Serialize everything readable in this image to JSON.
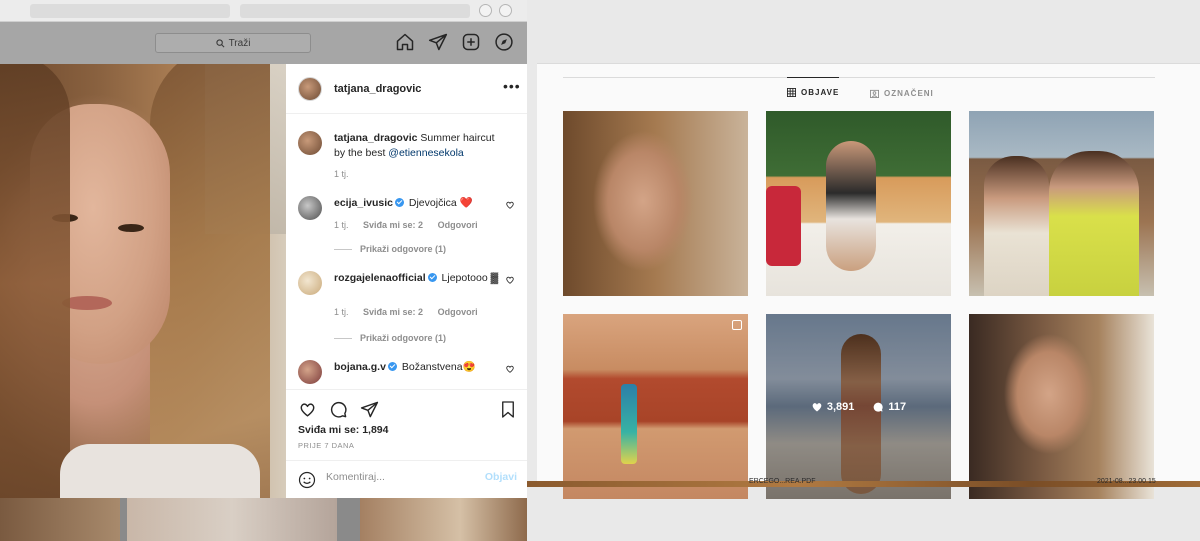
{
  "left_window": {
    "search": {
      "placeholder": "Traži"
    },
    "nav_icons": [
      "home-icon",
      "direct-icon",
      "new-post-icon",
      "explore-icon",
      "activity-icon"
    ],
    "post": {
      "username": "tatjana_dragovic",
      "caption": {
        "username": "tatjana_dragovic",
        "text": "Summer haircut by the best",
        "mention": "@etiennesekola",
        "time": "1 tj."
      },
      "comments": [
        {
          "username": "ecija_ivusic",
          "verified": true,
          "text": "Djevojčica ❤️",
          "time": "1 tj.",
          "likes": "Sviđa mi se: 2",
          "reply_label": "Odgovori",
          "view_replies": "Prikaži odgovore (1)"
        },
        {
          "username": "rozgajelenaofficial",
          "verified": true,
          "text": "Ljepotooo ▓",
          "time": "1 tj.",
          "likes": "Sviđa mi se: 2",
          "reply_label": "Odgovori",
          "view_replies": "Prikaži odgovore (1)"
        },
        {
          "username": "bojana.g.v",
          "verified": true,
          "text": "Božanstvena😍"
        }
      ],
      "likes_text": "Sviđa mi se: 1,894",
      "date": "PRIJE 7 DANA",
      "comment_placeholder": "Komentiraj...",
      "post_button": "Objavi"
    }
  },
  "right_window": {
    "tabs": [
      {
        "label": "OBJAVE",
        "icon": "grid-icon",
        "active": true
      },
      {
        "label": "OZNAČENI",
        "icon": "tagged-icon",
        "active": false
      }
    ],
    "hover_stats": {
      "likes": "3,891",
      "comments": "117"
    },
    "status_strip": [
      "ERCEGO...REA.PDF",
      "2021-08...23.00.15"
    ]
  },
  "colors": {
    "accent_blue": "#3897f0",
    "post_button_disabled": "#b2dffc",
    "text_primary": "#262626",
    "text_secondary": "#8e8e8e"
  }
}
